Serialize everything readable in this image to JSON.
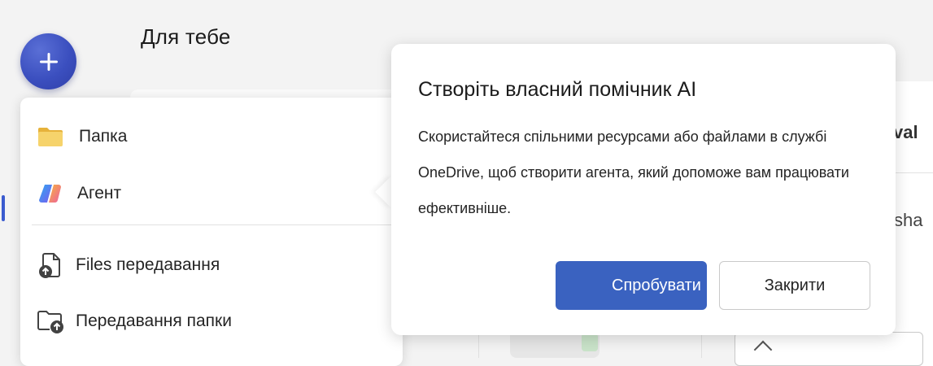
{
  "page": {
    "title": "Для тебе"
  },
  "fab": {
    "icon": "plus-icon"
  },
  "background": {
    "eval_fragment": "val",
    "share_fragment": "l sha"
  },
  "menu": {
    "items": [
      {
        "label": "Папка",
        "icon": "folder-icon"
      },
      {
        "label": "Агент",
        "icon": "copilot-agent-icon"
      },
      {
        "label": "Files передавання",
        "icon": "file-upload-icon"
      },
      {
        "label": "Передавання папки",
        "icon": "folder-upload-icon"
      }
    ]
  },
  "popover": {
    "title": "Створіть власний помічник AI",
    "body_lines": [
      "Скористайтеся спільними ресурсами або файлами в службі",
      "OneDrive, щоб створити агента, який допоможе вам працювати",
      "ефективніше."
    ],
    "primary_button": "Спробувати",
    "secondary_button": "Закрити"
  },
  "colors": {
    "accent": "#3a62c0",
    "fab": "#3b4fbf",
    "folder": "#f2c94c"
  }
}
